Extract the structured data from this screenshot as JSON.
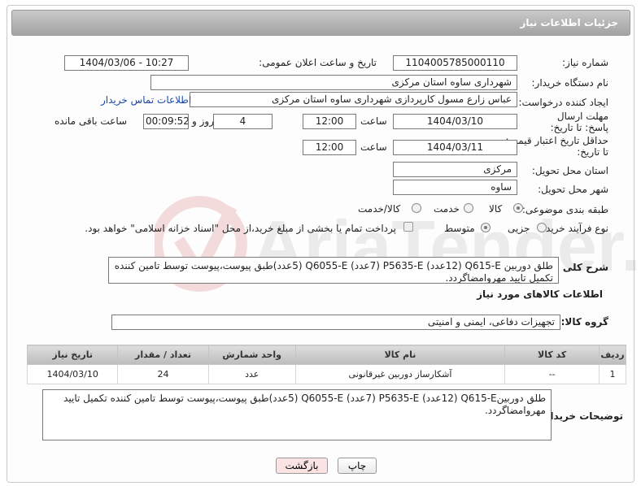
{
  "header": {
    "title": "جزئیات اطلاعات نیاز"
  },
  "labels": {
    "need_number": "شماره نیاز:",
    "announce_datetime": "تاریخ و ساعت اعلان عمومی:",
    "buyer_org": "نام دستگاه خریدار:",
    "requester": "ایجاد کننده درخواست:",
    "reply_deadline": "مهلت ارسال پاسخ: تا تاریخ:",
    "price_validity": "حداقل تاریخ اعتبار قیمت: تا تاریخ:",
    "hour": "ساعت",
    "days_and": "روز و",
    "remaining": "ساعت باقی مانده",
    "province": "استان محل تحویل:",
    "city": "شهر محل تحویل:",
    "category": "طبقه بندی موضوعی:",
    "process_type": "نوع فرآیند خرید :",
    "general_description": "شرح کلی نیاز:",
    "goods_info": "اطلاعات کالاهای مورد نیاز",
    "goods_group": "گروه کالا:",
    "buyer_notes": "توضیحات خریدار:"
  },
  "fields": {
    "need_number": "1104005785000110",
    "announce_datetime": "1404/03/06 - 10:27",
    "buyer_org": "شهرداری ساوه استان مرکزی",
    "requester": "عباس زارع مسول کارپردازی شهرداری ساوه استان مرکزی",
    "contact_link": "اطلاعات تماس خریدار",
    "reply_date": "1404/03/10",
    "reply_time": "12:00",
    "remaining_days": "4",
    "remaining_time": "00:09:52",
    "validity_date": "1404/03/11",
    "validity_time": "12:00",
    "province": "مرکزی",
    "city": "ساوه"
  },
  "category_options": {
    "goods": "کالا",
    "service": "خدمت",
    "goods_service": "کالا/خدمت",
    "selected": "کالا"
  },
  "process_options": {
    "partial": "جزیی",
    "medium": "متوسط",
    "selected": "متوسط"
  },
  "payment_note": "پرداخت تمام یا بخشی از مبلغ خرید،از محل \"اسناد خزانه اسلامی\" خواهد بود.",
  "general_description": "طلق دوربین Q615-E (12عدد) P5635-E (7عدد) Q6055-E (5عدد)طبق پیوست،پیوست توسط تامین کننده تکمیل تایید  مهروامضاگردد.",
  "goods_group": "تجهیزات دفاعی، ایمنی و امنیتی",
  "table": {
    "headers": [
      "ردیف",
      "کد کالا",
      "نام کالا",
      "واحد شمارش",
      "تعداد / مقدار",
      "تاریخ نیاز"
    ],
    "rows": [
      [
        "1",
        "--",
        "آشکارساز دوربین غیرقانونی",
        "عدد",
        "24",
        "1404/03/10"
      ]
    ]
  },
  "buyer_notes": "طلق دوربینQ615-E (12عدد) P5635-E (7عدد) Q6055-E (5عدد)طبق پیوست،پیوست توسط تامین کننده تکمیل تایید مهروامضاگردد.",
  "buttons": {
    "print": "چاپ",
    "back": "بازگشت"
  },
  "watermark": "AriaTender.neT",
  "colors": {
    "header_bg": "#b3b3b3",
    "link": "#1a48a8",
    "back_button": "#fbe3e3"
  }
}
